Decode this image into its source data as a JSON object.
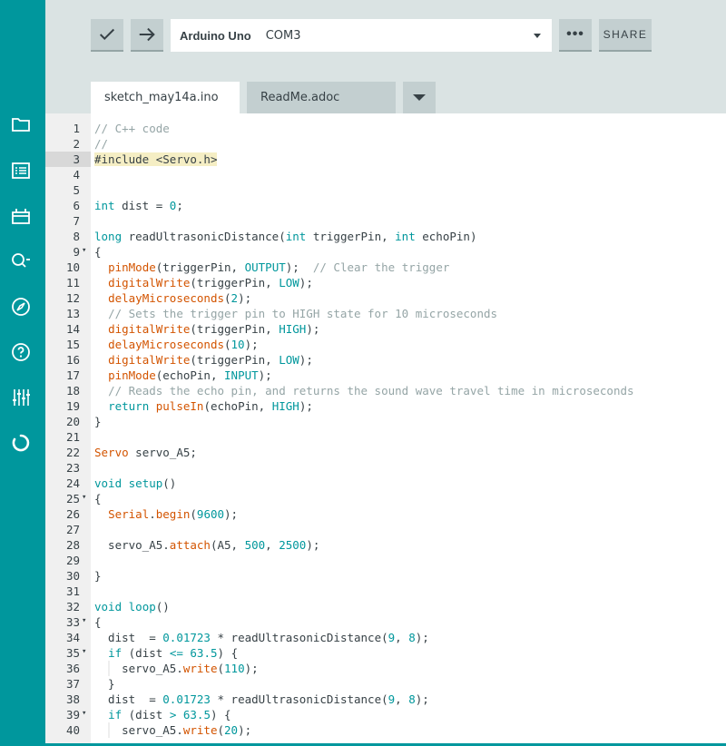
{
  "toolbar": {
    "verify_icon": "checkmark-icon",
    "upload_icon": "arrow-right-icon",
    "board": "Arduino Uno",
    "port": "COM3",
    "more_label": "•••",
    "share_label": "SHARE"
  },
  "tabs": [
    {
      "label": "sketch_may14a.ino",
      "active": true
    },
    {
      "label": "ReadMe.adoc",
      "active": false
    }
  ],
  "sidebar": {
    "icons": [
      "folder-icon",
      "list-icon",
      "library-icon",
      "search-icon",
      "compass-icon",
      "help-icon",
      "sliders-icon",
      "loading-icon"
    ]
  },
  "colors": {
    "accent": "#00979d",
    "keyword": "#00979c",
    "function": "#d35400",
    "constant": "#00979c",
    "comment": "#95a5a6",
    "preprocessor_bg": "#f5eec4"
  },
  "editor": {
    "current_line": 3,
    "lines": [
      [
        [
          "// C++ code",
          "c"
        ]
      ],
      [
        [
          "//",
          "c"
        ]
      ],
      [
        [
          "#include",
          "p"
        ],
        [
          " <Servo.h>",
          "h"
        ]
      ],
      [],
      [],
      [
        [
          "int",
          "k"
        ],
        [
          " dist = ",
          "t"
        ],
        [
          "0",
          "n"
        ],
        [
          ";",
          "t"
        ]
      ],
      [],
      [
        [
          "long",
          "k"
        ],
        [
          " readUltrasonicDistance(",
          "t"
        ],
        [
          "int",
          "k"
        ],
        [
          " triggerPin, ",
          "t"
        ],
        [
          "int",
          "k"
        ],
        [
          " echoPin)",
          "t"
        ]
      ],
      [
        [
          "{",
          "t"
        ]
      ],
      [
        [
          "  ",
          "t"
        ],
        [
          "pinMode",
          "f"
        ],
        [
          "(triggerPin, ",
          "t"
        ],
        [
          "OUTPUT",
          "k"
        ],
        [
          ");  ",
          "t"
        ],
        [
          "// Clear the trigger",
          "c"
        ]
      ],
      [
        [
          "  ",
          "t"
        ],
        [
          "digitalWrite",
          "f"
        ],
        [
          "(triggerPin, ",
          "t"
        ],
        [
          "LOW",
          "k"
        ],
        [
          ");",
          "t"
        ]
      ],
      [
        [
          "  ",
          "t"
        ],
        [
          "delayMicroseconds",
          "f"
        ],
        [
          "(",
          "t"
        ],
        [
          "2",
          "n"
        ],
        [
          ");",
          "t"
        ]
      ],
      [
        [
          "  ",
          "t"
        ],
        [
          "// Sets the trigger pin to HIGH state for 10 microseconds",
          "c"
        ]
      ],
      [
        [
          "  ",
          "t"
        ],
        [
          "digitalWrite",
          "f"
        ],
        [
          "(triggerPin, ",
          "t"
        ],
        [
          "HIGH",
          "k"
        ],
        [
          ");",
          "t"
        ]
      ],
      [
        [
          "  ",
          "t"
        ],
        [
          "delayMicroseconds",
          "f"
        ],
        [
          "(",
          "t"
        ],
        [
          "10",
          "n"
        ],
        [
          ");",
          "t"
        ]
      ],
      [
        [
          "  ",
          "t"
        ],
        [
          "digitalWrite",
          "f"
        ],
        [
          "(triggerPin, ",
          "t"
        ],
        [
          "LOW",
          "k"
        ],
        [
          ");",
          "t"
        ]
      ],
      [
        [
          "  ",
          "t"
        ],
        [
          "pinMode",
          "f"
        ],
        [
          "(echoPin, ",
          "t"
        ],
        [
          "INPUT",
          "k"
        ],
        [
          ");",
          "t"
        ]
      ],
      [
        [
          "  ",
          "t"
        ],
        [
          "// Reads the echo pin, and returns the sound wave travel time in microseconds",
          "c"
        ]
      ],
      [
        [
          "  ",
          "t"
        ],
        [
          "return",
          "k"
        ],
        [
          " ",
          "t"
        ],
        [
          "pulseIn",
          "f"
        ],
        [
          "(echoPin, ",
          "t"
        ],
        [
          "HIGH",
          "k"
        ],
        [
          ");",
          "t"
        ]
      ],
      [
        [
          "}",
          "t"
        ]
      ],
      [],
      [
        [
          "Servo",
          "f"
        ],
        [
          " servo_A5;",
          "t"
        ]
      ],
      [],
      [
        [
          "void",
          "k"
        ],
        [
          " ",
          "t"
        ],
        [
          "setup",
          "k"
        ],
        [
          "()",
          "t"
        ]
      ],
      [
        [
          "{",
          "t"
        ]
      ],
      [
        [
          "  ",
          "t"
        ],
        [
          "Serial",
          "f"
        ],
        [
          ".",
          "t"
        ],
        [
          "begin",
          "f"
        ],
        [
          "(",
          "t"
        ],
        [
          "9600",
          "n"
        ],
        [
          ");",
          "t"
        ]
      ],
      [],
      [
        [
          "  servo_A5.",
          "t"
        ],
        [
          "attach",
          "f"
        ],
        [
          "(A5, ",
          "t"
        ],
        [
          "500",
          "n"
        ],
        [
          ", ",
          "t"
        ],
        [
          "2500",
          "n"
        ],
        [
          ");",
          "t"
        ]
      ],
      [],
      [
        [
          "}",
          "t"
        ]
      ],
      [],
      [
        [
          "void",
          "k"
        ],
        [
          " ",
          "t"
        ],
        [
          "loop",
          "k"
        ],
        [
          "()",
          "t"
        ]
      ],
      [
        [
          "{",
          "t"
        ]
      ],
      [
        [
          "  dist  ",
          "t"
        ],
        [
          "=",
          "o"
        ],
        [
          " ",
          "t"
        ],
        [
          "0.01723",
          "n"
        ],
        [
          " * readUltrasonicDistance(",
          "t"
        ],
        [
          "9",
          "n"
        ],
        [
          ", ",
          "t"
        ],
        [
          "8",
          "n"
        ],
        [
          ");",
          "t"
        ]
      ],
      [
        [
          "  ",
          "t"
        ],
        [
          "if",
          "k"
        ],
        [
          " (dist ",
          "t"
        ],
        [
          "<=",
          "k"
        ],
        [
          " ",
          "t"
        ],
        [
          "63.5",
          "n"
        ],
        [
          ") {",
          "t"
        ]
      ],
      [
        [
          "    servo_A5.",
          "t"
        ],
        [
          "write",
          "f"
        ],
        [
          "(",
          "t"
        ],
        [
          "110",
          "n"
        ],
        [
          ");",
          "t"
        ]
      ],
      [
        [
          "  }",
          "t"
        ]
      ],
      [
        [
          "  dist  ",
          "t"
        ],
        [
          "=",
          "o"
        ],
        [
          " ",
          "t"
        ],
        [
          "0.01723",
          "n"
        ],
        [
          " * readUltrasonicDistance(",
          "t"
        ],
        [
          "9",
          "n"
        ],
        [
          ", ",
          "t"
        ],
        [
          "8",
          "n"
        ],
        [
          ");",
          "t"
        ]
      ],
      [
        [
          "  ",
          "t"
        ],
        [
          "if",
          "k"
        ],
        [
          " (dist ",
          "t"
        ],
        [
          ">",
          "k"
        ],
        [
          " ",
          "t"
        ],
        [
          "63.5",
          "n"
        ],
        [
          ") {",
          "t"
        ]
      ],
      [
        [
          "    servo_A5.",
          "t"
        ],
        [
          "write",
          "f"
        ],
        [
          "(",
          "t"
        ],
        [
          "20",
          "n"
        ],
        [
          ");",
          "t"
        ]
      ]
    ],
    "foldable": [
      9,
      25,
      33,
      35,
      39
    ],
    "guide_lines": [
      36,
      40
    ]
  }
}
